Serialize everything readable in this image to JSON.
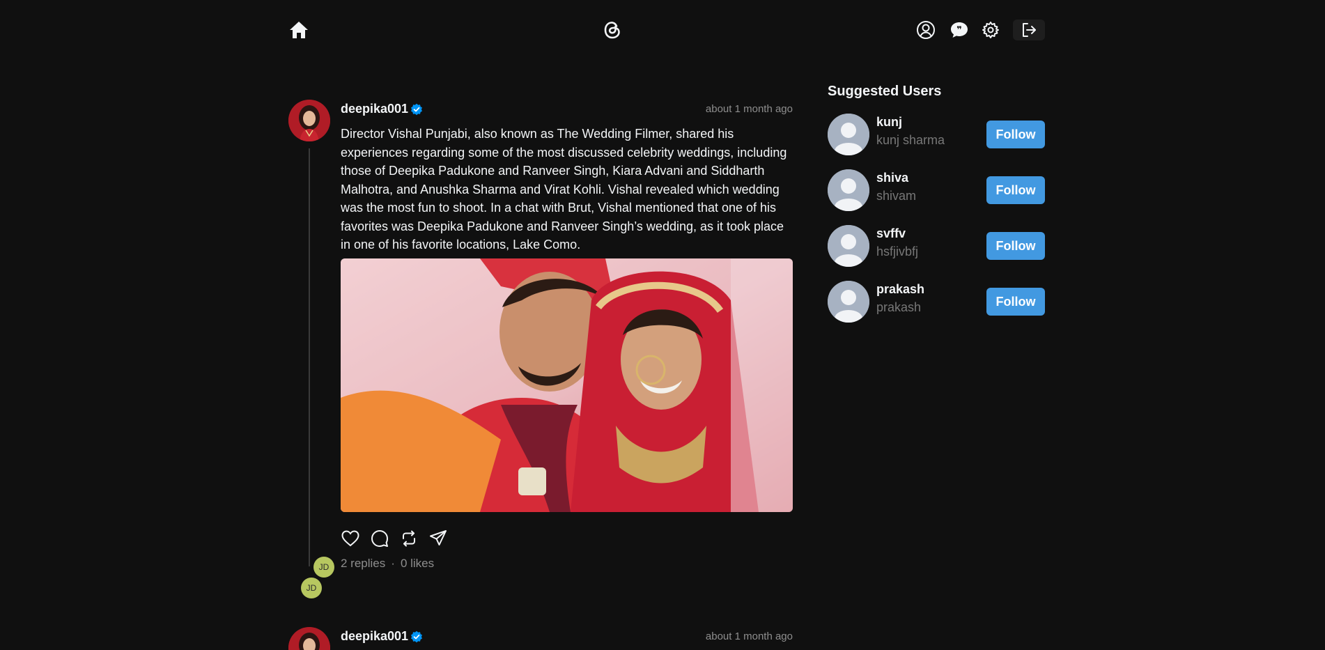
{
  "nav": {
    "home_icon": "home-icon",
    "logo_icon": "threads-logo-icon",
    "profile_icon": "user-circle-icon",
    "chat_icon": "chat-bubble-icon",
    "settings_icon": "gear-icon",
    "logout_icon": "logout-icon"
  },
  "posts": [
    {
      "username": "deepika001",
      "verified": true,
      "time": "about 1 month ago",
      "text": "Director Vishal Punjabi, also known as The Wedding Filmer, shared his experiences regarding some of the most discussed celebrity weddings, including those of Deepika Padukone and Ranveer Singh, Kiara Advani and Siddharth Malhotra, and Anushka Sharma and Virat Kohli. Vishal revealed which wedding was the most fun to shoot. In a chat with Brut, Vishal mentioned that one of his favorites was Deepika Padukone and Ranveer Singh’s wedding, as it took place in one of his favorite locations, Lake Como.",
      "replies": "2 replies",
      "separator": "·",
      "likes": "0 likes",
      "reply_avatars": [
        "JD",
        "JD"
      ]
    },
    {
      "username": "deepika001",
      "verified": true,
      "time": "about 1 month ago"
    }
  ],
  "sidebar": {
    "title": "Suggested Users",
    "users": [
      {
        "name": "kunj",
        "handle": "kunj sharma",
        "button": "Follow"
      },
      {
        "name": "shiva",
        "handle": "shivam",
        "button": "Follow"
      },
      {
        "name": "svffv",
        "handle": "hsfjivbfj",
        "button": "Follow"
      },
      {
        "name": "prakash",
        "handle": "prakash",
        "button": "Follow"
      }
    ]
  },
  "colors": {
    "background": "#101010",
    "text": "#f3f5f7",
    "muted": "#8e8e8e",
    "accent": "#4299e1",
    "verified": "#0095f6",
    "reply_avatar": "#b7c760"
  }
}
